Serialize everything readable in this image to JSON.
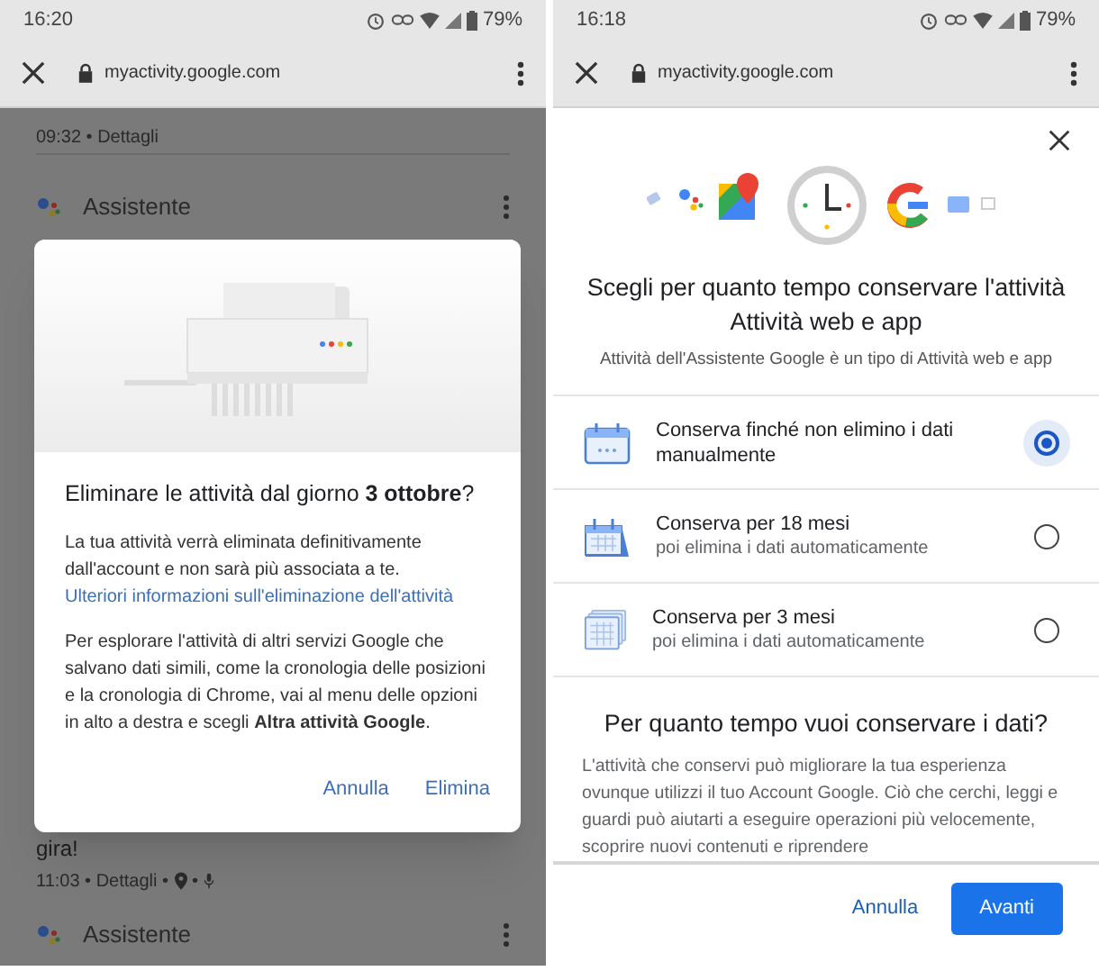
{
  "left_screen": {
    "status_bar": {
      "time": "16:20",
      "battery": "79%"
    },
    "browser_bar": {
      "url": "myactivity.google.com"
    },
    "feed": [
      {
        "kind": "meta",
        "text": "09:32 • Dettagli"
      },
      {
        "kind": "header",
        "label": "Assistente"
      },
      {
        "kind": "text",
        "text": "gira!"
      },
      {
        "kind": "meta",
        "text": "11:03 • Dettagli •",
        "sep": "•",
        "location_voice": true
      },
      {
        "kind": "header",
        "label": "Assistente"
      }
    ],
    "dialog": {
      "title": "Eliminare le attività dal giorno **3 ottobre**?",
      "paragraph": "La tua attività verrà eliminata definitivamente dall'account e non sarà più associata a te.",
      "link": "Ulteriori informazioni sull'eliminazione dell'attività",
      "paragraph_2": "Per esplorare l'attività di altri servizi Google che salvano dati simili, come la cronologia delle posizioni e la cronologia di Chrome, vai al menu delle opzioni in alto a destra e scegli **Altra attività Google**.",
      "buttons": [
        "Annulla",
        "Elimina"
      ]
    }
  },
  "right_screen": {
    "status_bar": {
      "time": "16:18",
      "battery": "79%"
    },
    "browser_bar": {
      "url": "myactivity.google.com"
    },
    "title": "Scegli per quanto tempo conservare l'attività Attività web e app",
    "subtitle": "Attività dell'Assistente Google è un tipo di Attività web e app",
    "options": [
      {
        "kind": "calendar",
        "title": "Conserva finché non elimino i dati manualmente",
        "selected": true
      },
      {
        "kind": "calendar_tilted",
        "title": "Conserva per 18 mesi",
        "detail": "poi elimina i dati automaticamente",
        "selected": false
      },
      {
        "kind": "calendar_stack",
        "title": "Conserva per 3 mesi",
        "detail": "poi elimina i dati automaticamente",
        "selected": false
      }
    ],
    "heading": "Per quanto tempo vuoi conservare i dati?",
    "paragraph": "L'attività che conservi può migliorare la tua esperienza ovunque utilizzi il tuo Account Google. Ciò che cerchi, leggi e guardi può aiutarti a eseguire operazioni più velocemente, scoprire nuovi contenuti e riprendere",
    "buttons": [
      {
        "label": "Annulla",
        "primary": false
      },
      {
        "label": "Avanti",
        "primary": true
      }
    ]
  }
}
